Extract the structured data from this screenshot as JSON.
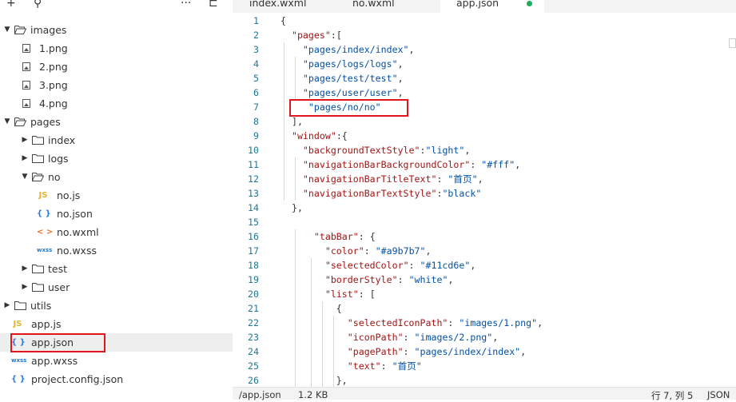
{
  "sidebar": {
    "toolbar": [
      {
        "name": "add-icon",
        "glyph": "+"
      },
      {
        "name": "search-icon",
        "glyph": "⚲"
      },
      {
        "name": "more-icon",
        "glyph": "···"
      },
      {
        "name": "collapse-icon",
        "glyph": "⊏"
      }
    ],
    "tree": [
      {
        "label": "images",
        "type": "folder",
        "level": 0,
        "open": true
      },
      {
        "label": "1.png",
        "type": "image",
        "level": 1
      },
      {
        "label": "2.png",
        "type": "image",
        "level": 1
      },
      {
        "label": "3.png",
        "type": "image",
        "level": 1
      },
      {
        "label": "4.png",
        "type": "image",
        "level": 1
      },
      {
        "label": "pages",
        "type": "folder",
        "level": 0,
        "open": true
      },
      {
        "label": "index",
        "type": "folder",
        "level": 1,
        "open": false
      },
      {
        "label": "logs",
        "type": "folder",
        "level": 1,
        "open": false
      },
      {
        "label": "no",
        "type": "folder",
        "level": 1,
        "open": true
      },
      {
        "label": "no.js",
        "type": "js",
        "level": 2
      },
      {
        "label": "no.json",
        "type": "json",
        "level": 2
      },
      {
        "label": "no.wxml",
        "type": "wxml",
        "level": 2
      },
      {
        "label": "no.wxss",
        "type": "wxss",
        "level": 2
      },
      {
        "label": "test",
        "type": "folder",
        "level": 1,
        "open": false
      },
      {
        "label": "user",
        "type": "folder",
        "level": 1,
        "open": false
      },
      {
        "label": "utils",
        "type": "folder",
        "level": 0,
        "open": false
      },
      {
        "label": "app.js",
        "type": "js",
        "level": 0
      },
      {
        "label": "app.json",
        "type": "json",
        "level": 0,
        "selected": true
      },
      {
        "label": "app.wxss",
        "type": "wxss",
        "level": 0
      },
      {
        "label": "project.config.json",
        "type": "json",
        "level": 0
      }
    ],
    "type_glyphs": {
      "js": "JS",
      "json": "{ }",
      "wxml": "< >",
      "wxss": "wxss"
    }
  },
  "tabs": [
    {
      "label": "index.wxml",
      "active": false
    },
    {
      "label": "no.wxml",
      "active": false
    },
    {
      "label": "app.json",
      "active": true,
      "unsaved": true
    }
  ],
  "editor": {
    "lines": [
      [
        [
          "{",
          "punc"
        ]
      ],
      [
        [
          "  ",
          "punc"
        ],
        [
          "\"pages\"",
          "key"
        ],
        [
          ":[",
          "punc"
        ]
      ],
      [
        [
          "    ",
          "punc"
        ],
        [
          "\"pages/index/index\"",
          "str"
        ],
        [
          ",",
          "punc"
        ]
      ],
      [
        [
          "    ",
          "punc"
        ],
        [
          "\"pages/logs/logs\"",
          "str"
        ],
        [
          ",",
          "punc"
        ]
      ],
      [
        [
          "    ",
          "punc"
        ],
        [
          "\"pages/test/test\"",
          "str"
        ],
        [
          ",",
          "punc"
        ]
      ],
      [
        [
          "    ",
          "punc"
        ],
        [
          "\"pages/user/user\"",
          "str"
        ],
        [
          ",",
          "punc"
        ]
      ],
      [
        [
          "     ",
          "punc"
        ],
        [
          "\"pages/no/no\"",
          "str"
        ]
      ],
      [
        [
          "  ],",
          "punc"
        ]
      ],
      [
        [
          "  ",
          "punc"
        ],
        [
          "\"window\"",
          "key"
        ],
        [
          ":{",
          "punc"
        ]
      ],
      [
        [
          "    ",
          "punc"
        ],
        [
          "\"backgroundTextStyle\"",
          "key"
        ],
        [
          ":",
          "punc"
        ],
        [
          "\"light\"",
          "str"
        ],
        [
          ",",
          "punc"
        ]
      ],
      [
        [
          "    ",
          "punc"
        ],
        [
          "\"navigationBarBackgroundColor\"",
          "key"
        ],
        [
          ": ",
          "punc"
        ],
        [
          "\"#fff\"",
          "str"
        ],
        [
          ",",
          "punc"
        ]
      ],
      [
        [
          "    ",
          "punc"
        ],
        [
          "\"navigationBarTitleText\"",
          "key"
        ],
        [
          ": ",
          "punc"
        ],
        [
          "\"首页\"",
          "str"
        ],
        [
          ",",
          "punc"
        ]
      ],
      [
        [
          "    ",
          "punc"
        ],
        [
          "\"navigationBarTextStyle\"",
          "key"
        ],
        [
          ":",
          "punc"
        ],
        [
          "\"black\"",
          "str"
        ]
      ],
      [
        [
          "  },",
          "punc"
        ]
      ],
      [
        [
          "",
          "punc"
        ]
      ],
      [
        [
          "      ",
          "punc"
        ],
        [
          "\"tabBar\"",
          "key"
        ],
        [
          ": {",
          "punc"
        ]
      ],
      [
        [
          "        ",
          "punc"
        ],
        [
          "\"color\"",
          "key"
        ],
        [
          ": ",
          "punc"
        ],
        [
          "\"#a9b7b7\"",
          "str"
        ],
        [
          ",",
          "punc"
        ]
      ],
      [
        [
          "        ",
          "punc"
        ],
        [
          "\"selectedColor\"",
          "key"
        ],
        [
          ": ",
          "punc"
        ],
        [
          "\"#11cd6e\"",
          "str"
        ],
        [
          ",",
          "punc"
        ]
      ],
      [
        [
          "        ",
          "punc"
        ],
        [
          "\"borderStyle\"",
          "key"
        ],
        [
          ": ",
          "punc"
        ],
        [
          "\"white\"",
          "str"
        ],
        [
          ",",
          "punc"
        ]
      ],
      [
        [
          "        ",
          "punc"
        ],
        [
          "\"list\"",
          "key"
        ],
        [
          ": [",
          "punc"
        ]
      ],
      [
        [
          "          {",
          "punc"
        ]
      ],
      [
        [
          "            ",
          "punc"
        ],
        [
          "\"selectedIconPath\"",
          "key"
        ],
        [
          ": ",
          "punc"
        ],
        [
          "\"images/1.png\"",
          "str"
        ],
        [
          ",",
          "punc"
        ]
      ],
      [
        [
          "            ",
          "punc"
        ],
        [
          "\"iconPath\"",
          "key"
        ],
        [
          ": ",
          "punc"
        ],
        [
          "\"images/2.png\"",
          "str"
        ],
        [
          ",",
          "punc"
        ]
      ],
      [
        [
          "            ",
          "punc"
        ],
        [
          "\"pagePath\"",
          "key"
        ],
        [
          ": ",
          "punc"
        ],
        [
          "\"pages/index/index\"",
          "str"
        ],
        [
          ",",
          "punc"
        ]
      ],
      [
        [
          "            ",
          "punc"
        ],
        [
          "\"text\"",
          "key"
        ],
        [
          ": ",
          "punc"
        ],
        [
          "\"首页\"",
          "str"
        ]
      ],
      [
        [
          "          },",
          "punc"
        ]
      ]
    ]
  },
  "status": {
    "path": "/app.json",
    "size": "1.2 KB",
    "position": "行 7, 列 5",
    "language": "JSON"
  },
  "colors": {
    "highlight": "#e0161b",
    "key": "#a31515",
    "string": "#0451a5",
    "line_number": "#237893",
    "unsaved_dot": "#1aad5a"
  }
}
